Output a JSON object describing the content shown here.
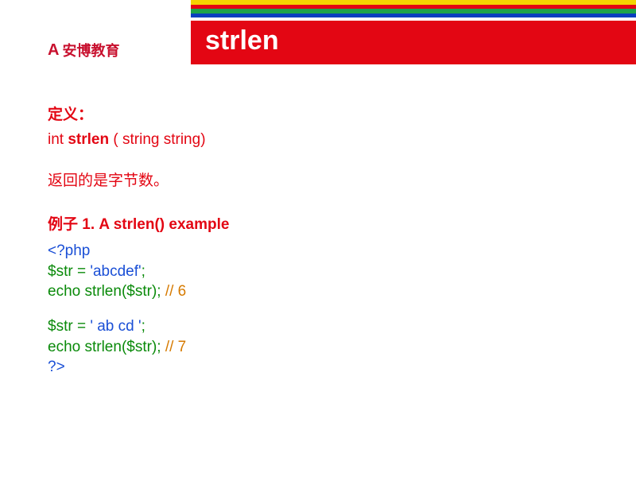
{
  "brand": {
    "mark": "A",
    "name": "安博教育"
  },
  "stripes": [
    "#f4d400",
    "#e30613",
    "#1ea34a",
    "#0a3fbf"
  ],
  "title": "strlen",
  "definition": {
    "label": "定义：",
    "sig_prefix": "int ",
    "sig_fn": "strlen",
    "sig_suffix": " ( string string)",
    "note": "返回的是字节数。"
  },
  "example": {
    "heading": "例子 1. A strlen() example",
    "open_tag": "<?php",
    "line1_a": "$str = ",
    "line1_b": "'abcdef'",
    "line1_c": ";",
    "line2_a": "echo strlen($str);",
    "line2_b": "  // 6",
    "line3_a": "$str = ",
    "line3_b": "' ab cd '",
    "line3_c": ";",
    "line4_a": "echo strlen($str);",
    "line4_b": "  // 7",
    "close_tag": "?>"
  }
}
